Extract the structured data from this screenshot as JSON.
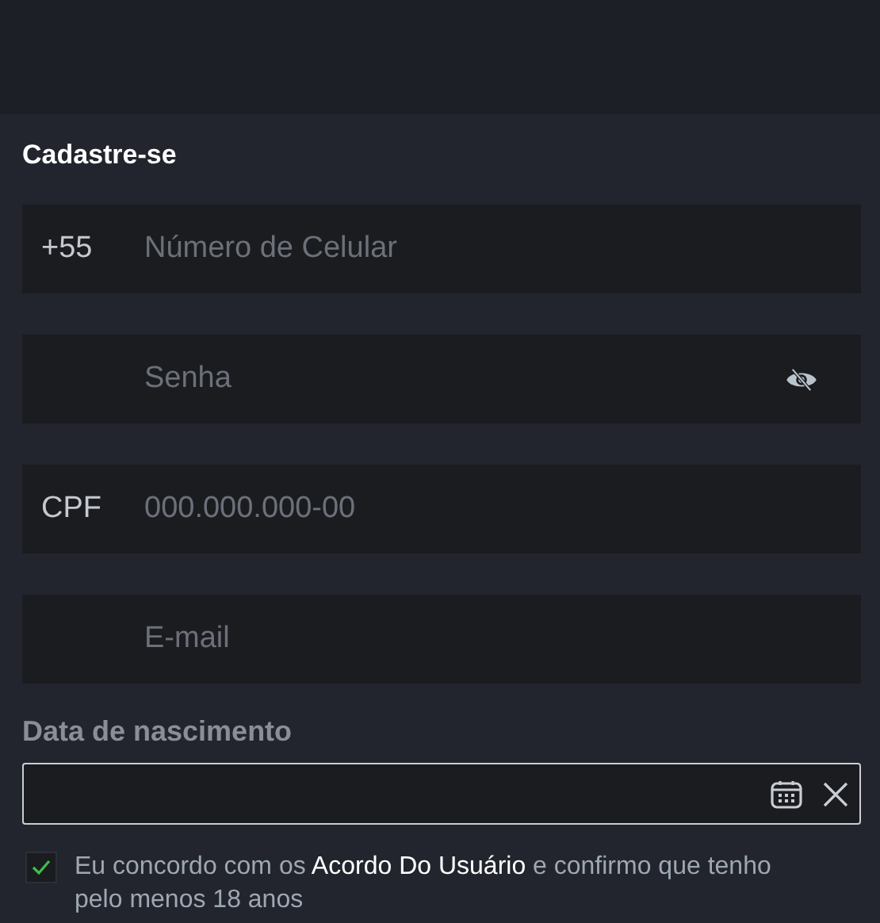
{
  "title": "Cadastre-se",
  "fields": [
    {
      "kind": "phone",
      "prefix": "+55",
      "placeholder": "Número de Celular"
    },
    {
      "kind": "password",
      "placeholder": "Senha"
    },
    {
      "kind": "cpf",
      "prefix": "CPF",
      "placeholder": "000.000.000-00"
    },
    {
      "kind": "email",
      "placeholder": "E-mail"
    }
  ],
  "birth_date": {
    "label": "Data de nascimento"
  },
  "agreement": {
    "checked": true,
    "text_before": "Eu concordo com os",
    "link": "Acordo Do Usuário",
    "text_after": "e confirmo que tenho pelo menos 18 anos"
  }
}
